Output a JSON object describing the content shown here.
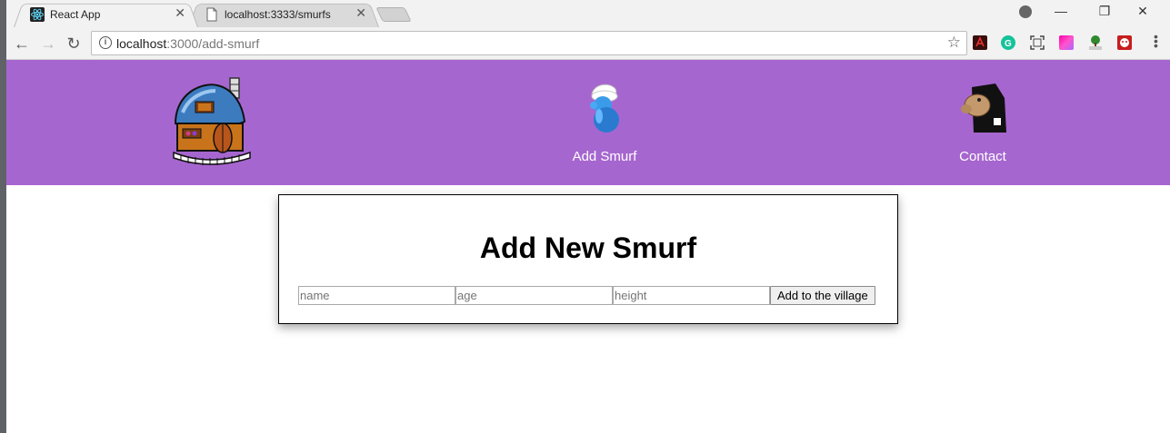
{
  "browser": {
    "tabs": [
      {
        "title": "React App",
        "active": true,
        "favicon": "react-icon"
      },
      {
        "title": "localhost:3333/smurfs",
        "active": false,
        "favicon": "page-icon"
      }
    ],
    "address": {
      "host": "localhost",
      "path": ":3000/add-smurf"
    },
    "extensions": [
      "acrobat-icon",
      "grammarly-icon",
      "screenshot-icon",
      "color-picker-icon",
      "html-validator-icon",
      "ghostery-icon"
    ]
  },
  "nav": {
    "home_icon": "smurf-house-icon",
    "add_label": "Add Smurf",
    "add_icon": "smurf-icon",
    "contact_label": "Contact",
    "contact_icon": "gargamel-icon"
  },
  "form": {
    "heading": "Add New Smurf",
    "name_placeholder": "name",
    "age_placeholder": "age",
    "height_placeholder": "height",
    "submit_label": "Add to the village"
  },
  "colors": {
    "navbar": "#a666cf",
    "nav_text": "#ffffff"
  }
}
